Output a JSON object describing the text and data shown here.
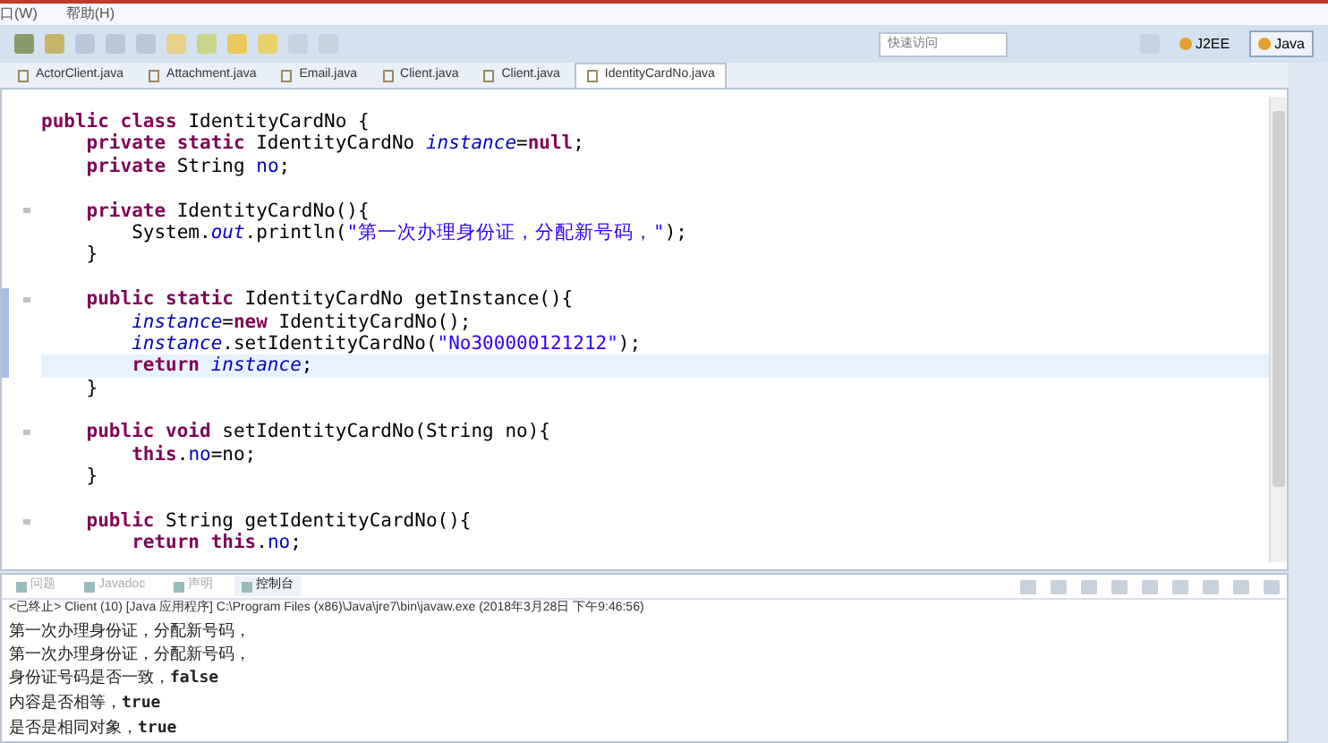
{
  "menu_bar": {
    "items": [
      "口(W)",
      "帮助(H)"
    ]
  },
  "toolbar": {
    "quick_access": {
      "placeholder": "快速访问"
    },
    "perspectives": [
      {
        "label": "J2EE",
        "selected": false
      },
      {
        "label": "Java",
        "selected": true
      }
    ]
  },
  "editor_tabs": [
    {
      "label": "ActorClient.java",
      "selected": false
    },
    {
      "label": "Attachment.java",
      "selected": false
    },
    {
      "label": "Email.java",
      "selected": false
    },
    {
      "label": "Client.java",
      "selected": false
    },
    {
      "label": "Client.java",
      "selected": false
    },
    {
      "label": "IdentityCardNo.java",
      "selected": true
    }
  ],
  "code_blocks": [
    {
      "lines": [
        {
          "tokens": [
            {
              "kind": "kw",
              "text": "public class "
            },
            {
              "kind": "plain",
              "text": "IdentityCardNo {"
            }
          ]
        },
        {
          "tokens": [
            {
              "kind": "kw",
              "text": "    private static "
            },
            {
              "kind": "plain",
              "text": "IdentityCardNo "
            },
            {
              "kind": "static",
              "text": "instance"
            },
            {
              "kind": "plain",
              "text": "="
            },
            {
              "kind": "kw",
              "text": "null"
            },
            {
              "kind": "plain",
              "text": ";"
            }
          ]
        },
        {
          "tokens": [
            {
              "kind": "kw",
              "text": "    private "
            },
            {
              "kind": "plain",
              "text": "String "
            },
            {
              "kind": "field",
              "text": "no"
            },
            {
              "kind": "plain",
              "text": ";"
            }
          ]
        }
      ]
    },
    {
      "lines": [
        {
          "fold": true,
          "tokens": [
            {
              "kind": "kw",
              "text": "    private "
            },
            {
              "kind": "plain",
              "text": "IdentityCardNo(){"
            }
          ]
        },
        {
          "tokens": [
            {
              "kind": "plain",
              "text": "        System."
            },
            {
              "kind": "static",
              "text": "out"
            },
            {
              "kind": "plain",
              "text": ".println("
            },
            {
              "kind": "str",
              "text": "\"第一次办理身份证，分配新号码，\""
            },
            {
              "kind": "plain",
              "text": ");"
            }
          ]
        },
        {
          "tokens": [
            {
              "kind": "plain",
              "text": "    }"
            }
          ]
        }
      ]
    },
    {
      "lines": [
        {
          "fold": true,
          "changed": true,
          "tokens": [
            {
              "kind": "kw",
              "text": "    public static "
            },
            {
              "kind": "plain",
              "text": "IdentityCardNo getInstance(){"
            }
          ]
        },
        {
          "changed": true,
          "tokens": [
            {
              "kind": "static",
              "text": "        instance"
            },
            {
              "kind": "plain",
              "text": "="
            },
            {
              "kind": "kw",
              "text": "new "
            },
            {
              "kind": "plain",
              "text": "IdentityCardNo();"
            }
          ]
        },
        {
          "changed": true,
          "tokens": [
            {
              "kind": "static",
              "text": "        instance"
            },
            {
              "kind": "plain",
              "text": ".setIdentityCardNo("
            },
            {
              "kind": "str",
              "text": "\"No300000121212\""
            },
            {
              "kind": "plain",
              "text": ");"
            }
          ]
        },
        {
          "changed": true,
          "highlighted": true,
          "tokens": [
            {
              "kind": "kw",
              "text": "        return "
            },
            {
              "kind": "static",
              "text": "instance"
            },
            {
              "kind": "plain",
              "text": ";"
            }
          ]
        },
        {
          "tokens": [
            {
              "kind": "plain",
              "text": "    }"
            }
          ]
        }
      ]
    },
    {
      "lines": [
        {
          "fold": true,
          "tokens": [
            {
              "kind": "kw",
              "text": "    public void "
            },
            {
              "kind": "plain",
              "text": "setIdentityCardNo(String no){"
            }
          ]
        },
        {
          "tokens": [
            {
              "kind": "kw",
              "text": "        this"
            },
            {
              "kind": "plain",
              "text": "."
            },
            {
              "kind": "field",
              "text": "no"
            },
            {
              "kind": "plain",
              "text": "=no;"
            }
          ]
        },
        {
          "tokens": [
            {
              "kind": "plain",
              "text": "    }"
            }
          ]
        }
      ]
    },
    {
      "lines": [
        {
          "fold": true,
          "tokens": [
            {
              "kind": "kw",
              "text": "    public "
            },
            {
              "kind": "plain",
              "text": "String getIdentityCardNo(){"
            }
          ]
        },
        {
          "tokens": [
            {
              "kind": "kw",
              "text": "        return this"
            },
            {
              "kind": "plain",
              "text": "."
            },
            {
              "kind": "field",
              "text": "no"
            },
            {
              "kind": "plain",
              "text": ";"
            }
          ]
        }
      ]
    }
  ],
  "bottom_tabs": [
    {
      "label": "问题",
      "selected": false
    },
    {
      "label": "Javadoc",
      "selected": false
    },
    {
      "label": "声明",
      "selected": false
    },
    {
      "label": "控制台",
      "selected": true
    }
  ],
  "console": {
    "header": "<已终止> Client (10) [Java 应用程序] C:\\Program Files (x86)\\Java\\jre7\\bin\\javaw.exe (2018年3月28日 下午9:46:56)",
    "lines": [
      "第一次办理身份证，分配新号码，",
      "第一次办理身份证，分配新号码，",
      "身份证号码是否一致，**false**",
      "内容是否相等，**true**",
      "是否是相同对象，**true**"
    ]
  }
}
